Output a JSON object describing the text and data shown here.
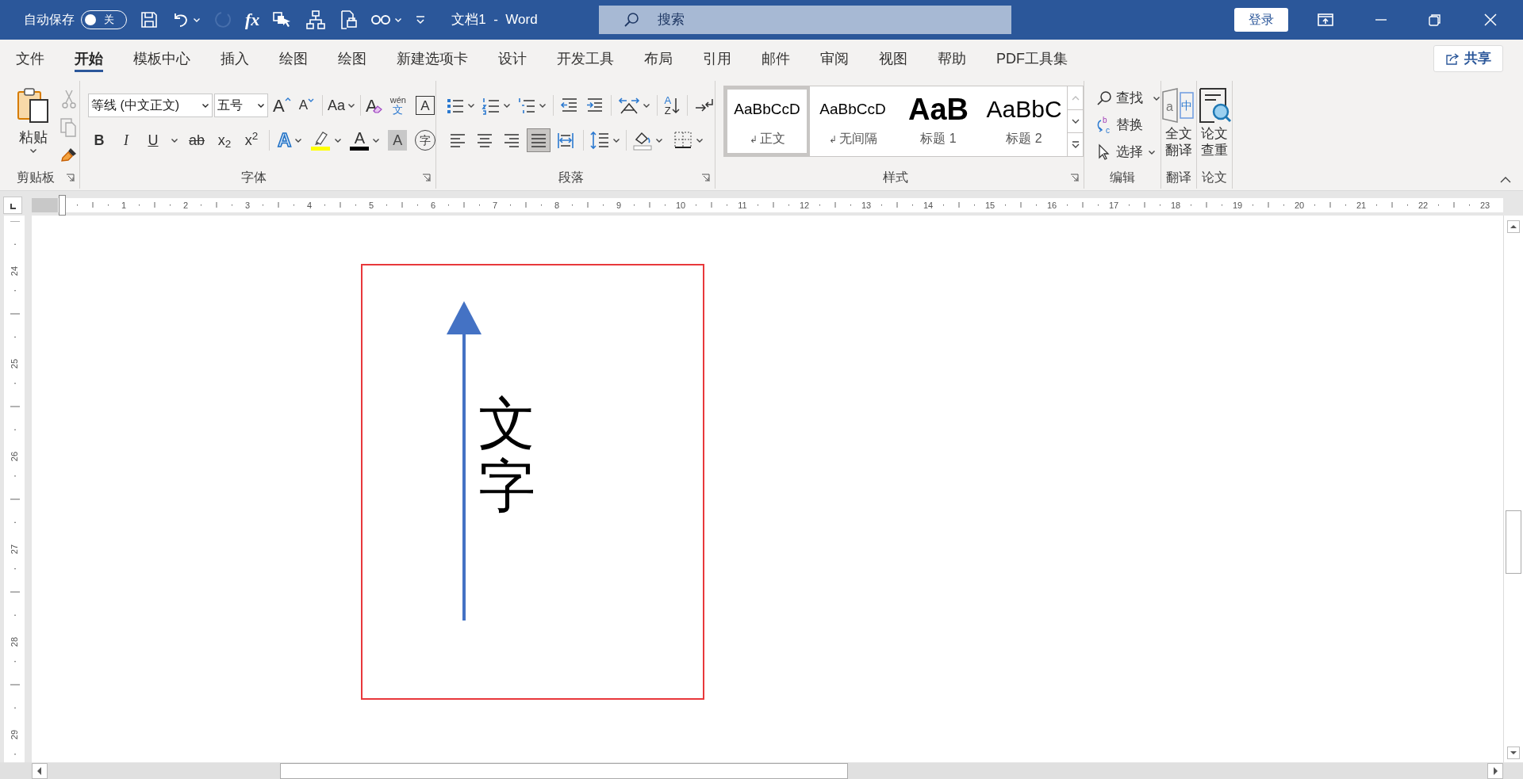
{
  "title_bar": {
    "autosave_label": "自动保存",
    "autosave": {
      "on": false,
      "label": "关"
    },
    "undo": {
      "disabled": false
    },
    "redo": {
      "disabled": true
    },
    "formula_button": "fx",
    "document_title": "文档1  -  Word",
    "search": {
      "placeholder": "搜索"
    },
    "login_button": "登录"
  },
  "ribbon_tabs": [
    {
      "label": "文件",
      "selected": false
    },
    {
      "label": "开始",
      "selected": true
    },
    {
      "label": "模板中心",
      "selected": false
    },
    {
      "label": "插入",
      "selected": false
    },
    {
      "label": "绘图",
      "selected": false
    },
    {
      "label": "绘图",
      "selected": false
    },
    {
      "label": "新建选项卡",
      "selected": false
    },
    {
      "label": "设计",
      "selected": false
    },
    {
      "label": "开发工具",
      "selected": false
    },
    {
      "label": "布局",
      "selected": false
    },
    {
      "label": "引用",
      "selected": false
    },
    {
      "label": "邮件",
      "selected": false
    },
    {
      "label": "审阅",
      "selected": false
    },
    {
      "label": "视图",
      "selected": false
    },
    {
      "label": "帮助",
      "selected": false
    },
    {
      "label": "PDF工具集",
      "selected": false
    }
  ],
  "share_button": "共享",
  "clipboard": {
    "paste_button": "粘贴",
    "group_label": "剪贴板"
  },
  "font": {
    "font_name": "等线 (中文正文)",
    "font_size": "五号",
    "grow_font": "A",
    "shrink_font": "A",
    "change_case": "Aa",
    "clear_formatting": "A",
    "phonetic_guide": {
      "pinyin": "wén",
      "character": "文"
    },
    "character_border": "A",
    "format_buttons": [
      {
        "label": "B",
        "kind": "bold"
      },
      {
        "label": "I",
        "kind": "italic"
      },
      {
        "label": "U",
        "kind": "underline"
      },
      {
        "label": "ab",
        "kind": "strikethrough"
      },
      {
        "label": "x$_{2}$",
        "kind": "plain"
      },
      {
        "label": "x$^{2}$",
        "kind": "plain"
      }
    ],
    "text_effects": "A",
    "font_color": "A",
    "character_shading": "A",
    "enclose_characters": "字",
    "group_label": "字体"
  },
  "paragraph": {
    "alignment": [
      {
        "selected": false
      },
      {
        "selected": false
      },
      {
        "selected": false
      },
      {
        "selected": true
      },
      {
        "selected": false
      }
    ],
    "sort_letters": [
      "A",
      "Z"
    ],
    "group_label": "段落"
  },
  "styles": {
    "items": [
      {
        "kind": "normal",
        "preview": "AaBbCcD",
        "paragraph_mark": "↲",
        "name": "正文",
        "selected": true
      },
      {
        "kind": "normal",
        "preview": "AaBbCcD",
        "paragraph_mark": "↲",
        "name": "无间隔",
        "selected": false
      },
      {
        "kind": "heading1",
        "preview": "AaB",
        "name": "标题 1",
        "selected": false
      },
      {
        "kind": "heading2",
        "preview": "AaBbC",
        "name": "标题 2",
        "selected": false
      }
    ],
    "group_label": "样式"
  },
  "editing": {
    "find": "查找",
    "replace": {
      "label": "替换",
      "icon_letters": [
        "b",
        "c"
      ]
    },
    "select": "选择",
    "group_label": "编辑"
  },
  "translate": {
    "button": "全文翻译",
    "icon_letters": [
      "a",
      "中"
    ],
    "group_label": "翻译"
  },
  "thesis": {
    "button": "论文查重",
    "group_label": "论文"
  },
  "ruler": {
    "horizontal": [
      "1",
      "2",
      "3",
      "4",
      "5",
      "6",
      "7",
      "8",
      "9",
      "10",
      "11",
      "12",
      "13",
      "14",
      "15",
      "16",
      "17",
      "18",
      "19",
      "20",
      "21",
      "22",
      "23"
    ],
    "vertical": [
      "24",
      "25",
      "26",
      "27",
      "28",
      "29"
    ]
  },
  "document": {
    "text_box": {
      "text": "文字"
    }
  }
}
